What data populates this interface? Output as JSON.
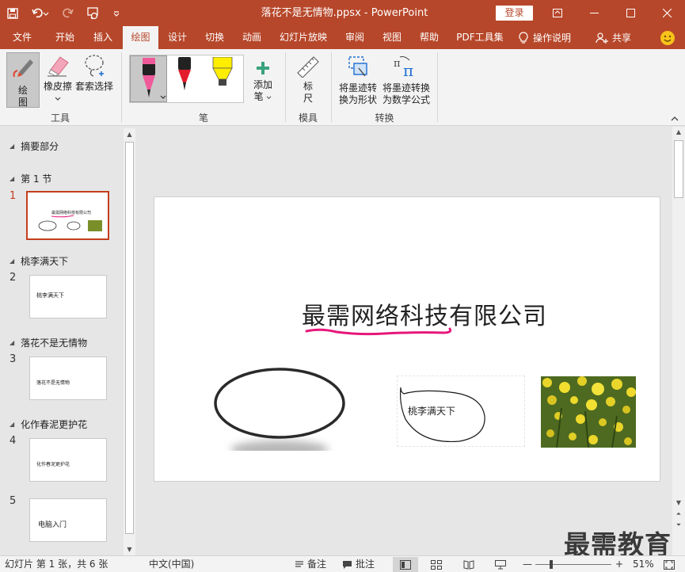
{
  "titlebar": {
    "document_title": "落花不是无情物.ppsx  -  PowerPoint",
    "login_label": "登录"
  },
  "tabs": [
    {
      "label": "文件"
    },
    {
      "label": "开始"
    },
    {
      "label": "插入"
    },
    {
      "label": "绘图"
    },
    {
      "label": "设计"
    },
    {
      "label": "切换"
    },
    {
      "label": "动画"
    },
    {
      "label": "幻灯片放映"
    },
    {
      "label": "审阅"
    },
    {
      "label": "视图"
    },
    {
      "label": "帮助"
    },
    {
      "label": "PDF工具集"
    }
  ],
  "tell_me": "操作说明",
  "share": "共享",
  "ribbon": {
    "tools": {
      "draw_line1": "绘",
      "draw_line2": "图",
      "eraser": "橡皮擦",
      "lasso": "套索选择",
      "group": "工具"
    },
    "pens": {
      "add_line1": "添加",
      "add_line2": "笔",
      "group": "笔"
    },
    "stencils": {
      "ruler_line1": "标",
      "ruler_line2": "尺",
      "group": "模具"
    },
    "convert": {
      "to_shape_line1": "将墨迹转",
      "to_shape_line2": "换为形状",
      "to_math_line1": "将墨迹转换",
      "to_math_line2": "为数学公式",
      "group": "转换"
    }
  },
  "sections": [
    {
      "title": "摘要部分"
    },
    {
      "title": "第 1 节"
    },
    {
      "title": "桃李满天下"
    },
    {
      "title": "落花不是无情物"
    },
    {
      "title": "化作春泥更护花"
    }
  ],
  "slides": [
    {
      "number": "1",
      "thumb_text": "最需网络科技有限公司"
    },
    {
      "number": "2",
      "thumb_text": "桃李满天下"
    },
    {
      "number": "3",
      "thumb_text": "落花不是无情物"
    },
    {
      "number": "4",
      "thumb_text": "化作春泥更护花"
    },
    {
      "number": "5",
      "thumb_text": "电脑入门"
    }
  ],
  "slide": {
    "title": "最需网络科技有限公司",
    "textbox_label": "桃李满天下"
  },
  "watermark": "最需教育",
  "statusbar": {
    "slide_info": "幻灯片 第 1 张，共 6 张",
    "language": "中文(中国)",
    "notes": "备注",
    "comments": "批注",
    "zoom": "51%"
  },
  "colors": {
    "accent": "#b7472a",
    "selected": "#c43e1c",
    "ink_pink": "#e6177a"
  }
}
